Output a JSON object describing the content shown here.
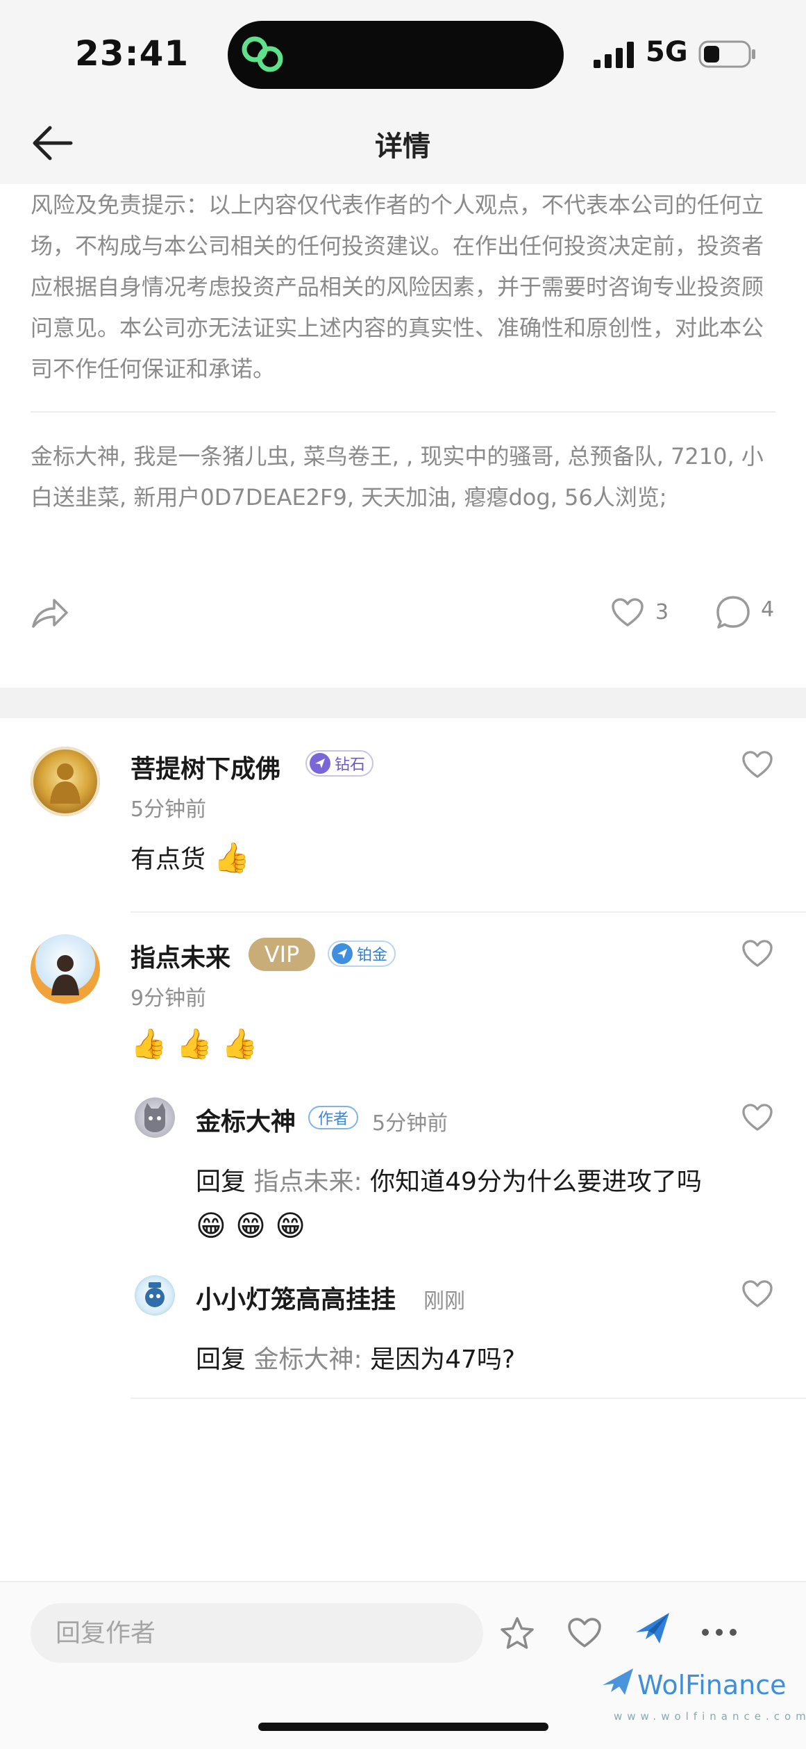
{
  "status_bar": {
    "time": "23:41",
    "network": "5G"
  },
  "nav": {
    "title": "详情"
  },
  "post": {
    "disclaimer": "风险及免责提示：以上内容仅代表作者的个人观点，不代表本公司的任何立场，不构成与本公司相关的任何投资建议。在作出任何投资决定前，投资者应根据自身情况考虑投资产品相关的风险因素，并于需要时咨询专业投资顾问意见。本公司亦无法证实上述内容的真实性、准确性和原创性，对此本公司不作任何保证和承诺。",
    "viewers": "金标大神, 我是一条猪儿虫, 菜鸟卷王, , 现实中的骚哥, 总预备队, 7210, 小白送韭菜, 新用户0D7DEAE2F9, 天天加油, 瘪瘪dog, 56人浏览;",
    "like_count": "3",
    "comment_count": "4"
  },
  "comments": [
    {
      "user": "菩提树下成佛",
      "badge": "钻石",
      "time": "5分钟前",
      "text": "有点货",
      "emoji": "👍"
    },
    {
      "user": "指点未来",
      "vip": "VIP",
      "badge": "铂金",
      "time": "9分钟前",
      "emoji": "👍 👍 👍",
      "replies": [
        {
          "user": "金标大神",
          "tag": "作者",
          "time": "5分钟前",
          "prefix": "回复",
          "target": "指点未来:",
          "text": "你知道49分为什么要进攻了吗",
          "emoji": "😁 😁 😁"
        },
        {
          "user": "小小灯笼高高挂挂",
          "time": "刚刚",
          "prefix": "回复",
          "target": "金标大神:",
          "text": "是因为47吗?"
        }
      ]
    }
  ],
  "bottom_bar": {
    "reply_placeholder": "回复作者"
  },
  "watermark": {
    "brand": "WolFinance",
    "url": "www.wolfinance.com"
  }
}
